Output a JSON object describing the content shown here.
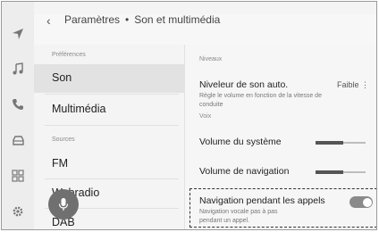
{
  "breadcrumb": {
    "back_icon": "chevron-left",
    "parent": "Paramètres",
    "separator": "•",
    "current": "Son et multimédia"
  },
  "nav": [
    {
      "icon": "navigation-arrow-icon"
    },
    {
      "icon": "music-note-icon"
    },
    {
      "icon": "phone-icon"
    },
    {
      "icon": "car-icon"
    },
    {
      "icon": "apps-grid-icon"
    },
    {
      "icon": "gear-icon"
    }
  ],
  "list": {
    "section_preferences": "Préférences",
    "son": "Son",
    "multimedia": "Multimédia",
    "section_sources": "Sources",
    "fm": "FM",
    "webradio": "Webradio",
    "dab": "DAB"
  },
  "detail": {
    "section_niveaux": "Niveaux",
    "auto_level_label": "Niveleur de son auto.",
    "auto_level_value": "Faible",
    "auto_level_desc": "Règle le volume en fonction de la vitesse de conduite",
    "section_voix": "Voix",
    "system_volume_label": "Volume du système",
    "system_volume_level": 0.55,
    "nav_volume_label": "Volume de navigation",
    "nav_volume_level": 0.55,
    "nav_calls_label": "Navigation pendant les appels",
    "nav_calls_desc": "Navigation vocale pas à pas pendant un appel.",
    "nav_calls_on": true
  },
  "colors": {
    "toggle_on": "#8a8a8a",
    "mic": "#707070"
  }
}
